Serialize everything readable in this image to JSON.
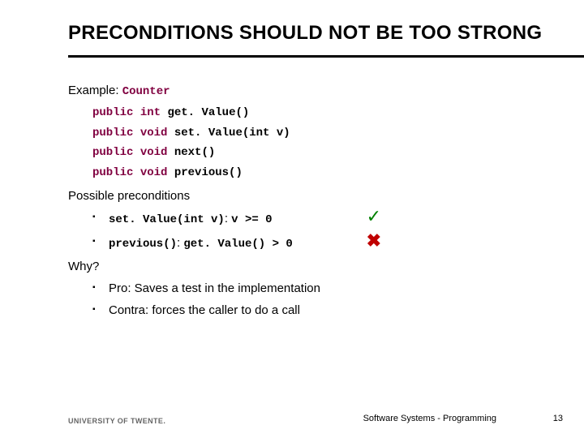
{
  "title": "PRECONDITIONS SHOULD NOT BE TOO STRONG",
  "example": {
    "label": "Example:",
    "class_name": "Counter",
    "signatures": [
      {
        "kw": "public",
        "type": "int",
        "name": "get. Value()"
      },
      {
        "kw": "public",
        "type": "void",
        "name": "set. Value(int v)"
      },
      {
        "kw": "public",
        "type": "void",
        "name": "next()"
      },
      {
        "kw": "public",
        "type": "void",
        "name": "previous()"
      }
    ]
  },
  "preconditions": {
    "heading": "Possible preconditions",
    "items": [
      {
        "method": "set. Value(int v)",
        "sep": ": ",
        "cond": "v >= 0",
        "mark": "✓",
        "mark_ok": true
      },
      {
        "method": "previous()",
        "sep": ": ",
        "cond": "get. Value() > 0",
        "mark": "✖",
        "mark_ok": false
      }
    ]
  },
  "why": {
    "heading": "Why?",
    "points": [
      "Pro: Saves a test in the implementation",
      "Contra: forces the caller to do a call"
    ]
  },
  "footer": {
    "university": "UNIVERSITY OF TWENTE.",
    "course": "Software Systems - Programming",
    "page": "13"
  }
}
